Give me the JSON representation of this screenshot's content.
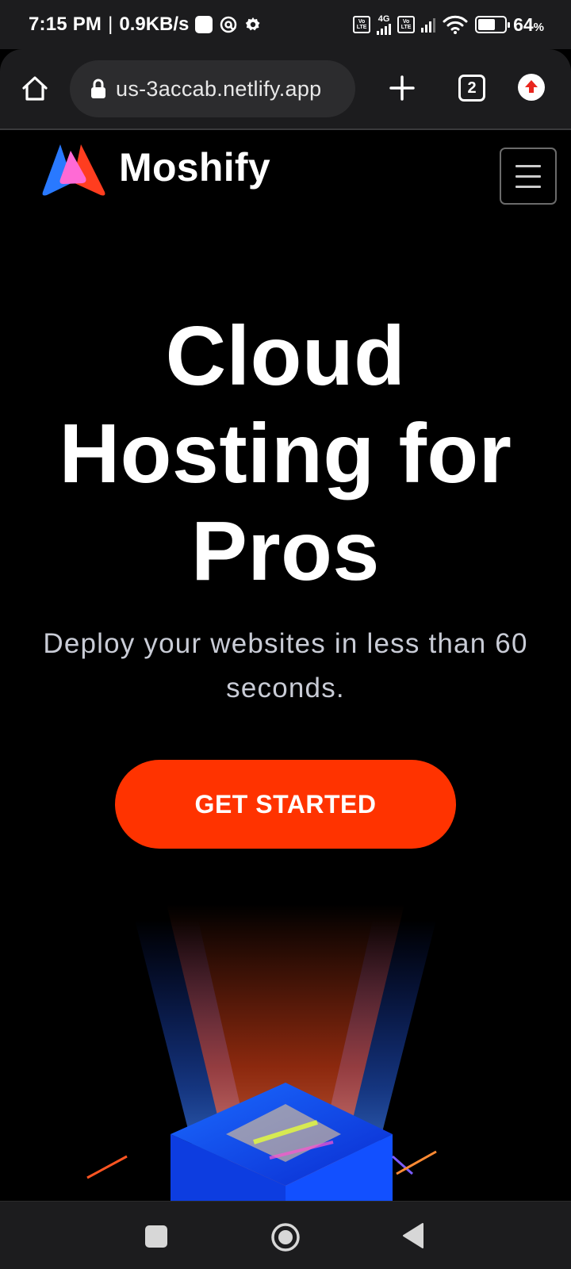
{
  "status_bar": {
    "time": "7:15 PM",
    "separator": "|",
    "speed": "0.9KB/s",
    "network_label": "4G",
    "lte_top": "Vo",
    "lte_bottom": "LTE",
    "battery_pct": "64",
    "battery_unit": "%"
  },
  "browser": {
    "url": "us-3accab.netlify.app",
    "tab_count": "2"
  },
  "site": {
    "brand": "Moshify",
    "colors": {
      "accent": "#ff3300",
      "logo_blue": "#2979ff",
      "logo_red": "#ff3d1f",
      "logo_pink": "#ff6ad5"
    }
  },
  "hero": {
    "title_line1": "Cloud",
    "title_line2": "Hosting for",
    "title_line3": "Pros",
    "subtitle": "Deploy your websites in less than 60 seconds.",
    "cta_label": "GET STARTED"
  },
  "icons": {
    "home": "home-icon",
    "lock": "lock-icon",
    "new_tab": "plus-icon",
    "tabs": "tab-switcher-icon",
    "update": "update-arrow-icon",
    "menu": "hamburger-menu-icon",
    "nav_recents": "square-icon",
    "nav_home": "circle-icon",
    "nav_back": "triangle-back-icon"
  }
}
